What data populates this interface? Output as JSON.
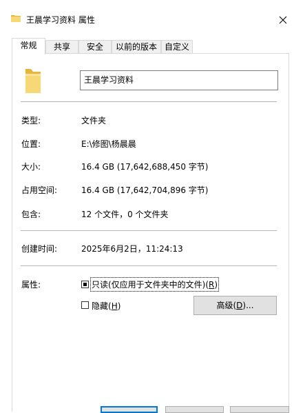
{
  "window": {
    "title": "王晨学习资料 属性",
    "close_icon": "close-icon"
  },
  "tabs": [
    {
      "label": "常规",
      "active": true
    },
    {
      "label": "共享",
      "active": false
    },
    {
      "label": "安全",
      "active": false
    },
    {
      "label": "以前的版本",
      "active": false
    },
    {
      "label": "自定义",
      "active": false
    }
  ],
  "general": {
    "folder_icon": "folder-icon",
    "name_value": "王晨学习资料",
    "type": {
      "label": "类型:",
      "value": "文件夹"
    },
    "location": {
      "label": "位置:",
      "value": "E:\\修图\\杨晨晨"
    },
    "size": {
      "label": "大小:",
      "value": "16.4 GB (17,642,688,450 字节)"
    },
    "size_on_disk": {
      "label": "占用空间:",
      "value": "16.4 GB (17,642,704,896 字节)"
    },
    "contains": {
      "label": "包含:",
      "value": "12 个文件，0 个文件夹"
    },
    "created": {
      "label": "创建时间:",
      "value": "2025年6月2日，11:24:13"
    },
    "attributes": {
      "label": "属性:",
      "readonly_label": "只读(仅应用于文件夹中的文件)(",
      "readonly_key": "R",
      "readonly_suffix": ")",
      "readonly_state": "indeterminate",
      "hidden_label": "隐藏(",
      "hidden_key": "H",
      "hidden_suffix": ")",
      "hidden_checked": false,
      "advanced_label": "高级(",
      "advanced_key": "D",
      "advanced_suffix": ")..."
    }
  },
  "colors": {
    "accent": "#0078d7",
    "folder_yellow": "#f8d775",
    "folder_dark": "#e8b43a"
  }
}
